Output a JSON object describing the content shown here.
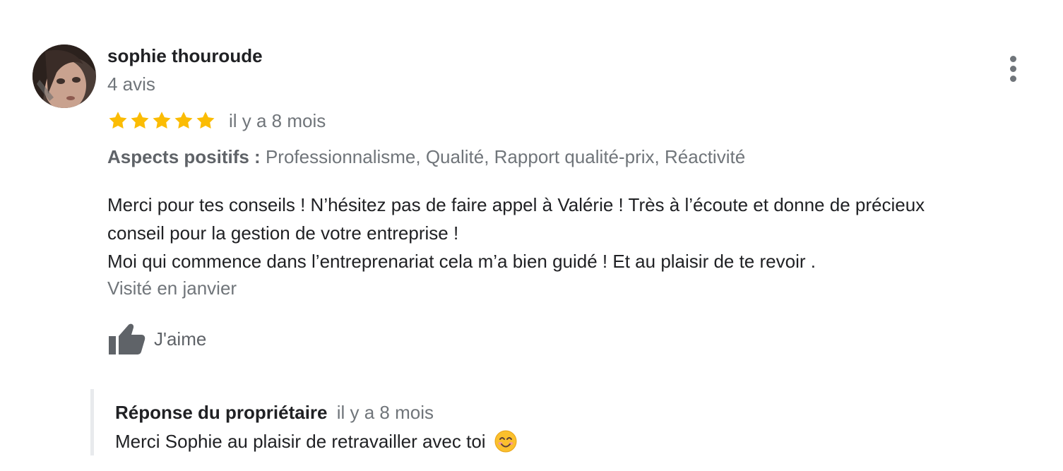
{
  "review": {
    "author": {
      "name": "sophie thouroude",
      "meta": "4 avis",
      "avatar_icon": "user-photo"
    },
    "rating": {
      "stars": 5,
      "max_stars": 5,
      "star_color": "#fbbc04"
    },
    "date": "il y a 8 mois",
    "aspects": {
      "label": "Aspects positifs :",
      "value": "Professionnalisme, Qualité, Rapport qualité-prix, Réactivité"
    },
    "text_lines": [
      "Merci pour tes conseils ! N’hésitez pas de faire appel à Valérie ! Très à l’écoute et donne de précieux",
      "conseil pour la gestion de votre entreprise !",
      "Moi qui commence dans l’entreprenariat cela m’a bien guidé ! Et au plaisir de te revoir ."
    ],
    "visited": "Visité en janvier",
    "like": {
      "label": "J'aime",
      "icon": "thumbs-up-icon"
    },
    "more_icon": "more-vert-icon"
  },
  "owner_response": {
    "title": "Réponse du propriétaire",
    "date": "il y a 8 mois",
    "text": "Merci Sophie au plaisir de retravailler avec toi",
    "emoji_icon": "smiling-face-icon"
  },
  "colors": {
    "primary_text": "#202124",
    "secondary_text": "#70757a",
    "star": "#fbbc04",
    "icon_gray": "#5f6368",
    "reply_border": "#e8eaed"
  }
}
